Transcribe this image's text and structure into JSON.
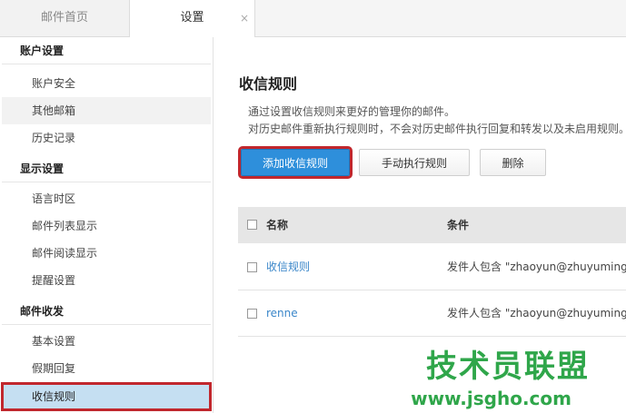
{
  "tabs": {
    "home": "邮件首页",
    "settings": "设置",
    "close": "×"
  },
  "sidebar": {
    "sections": [
      {
        "label": "账户设置",
        "items": [
          "账户安全",
          "其他邮箱",
          "历史记录"
        ]
      },
      {
        "label": "显示设置",
        "items": [
          "语言时区",
          "邮件列表显示",
          "邮件阅读显示",
          "提醒设置"
        ]
      },
      {
        "label": "邮件收发",
        "items": [
          "基本设置",
          "假期回复",
          "收信规则"
        ]
      }
    ],
    "active_item": "收信规则"
  },
  "main": {
    "title": "收信规则",
    "desc1": "通过设置收信规则来更好的管理你的邮件。",
    "desc2": "对历史邮件重新执行规则时，不会对历史邮件执行回复和转发以及未启用规则。",
    "buttons": {
      "add": "添加收信规则",
      "manual": "手动执行规则",
      "delete": "删除"
    },
    "table": {
      "headers": [
        "名称",
        "条件"
      ],
      "rows": [
        {
          "name": "收信规则",
          "condition": "发件人包含 \"zhaoyun@zhuyuming.so"
        },
        {
          "name": "renne",
          "condition": "发件人包含 \"zhaoyun@zhuyuming.so"
        }
      ]
    }
  },
  "watermark": {
    "line1": "技术员联盟",
    "line2": "www.jsgho.com"
  },
  "colors": {
    "accent": "#2e8fdb",
    "highlight": "#c1272d",
    "link": "#3a86c9",
    "active_bg": "#c5dff2"
  }
}
